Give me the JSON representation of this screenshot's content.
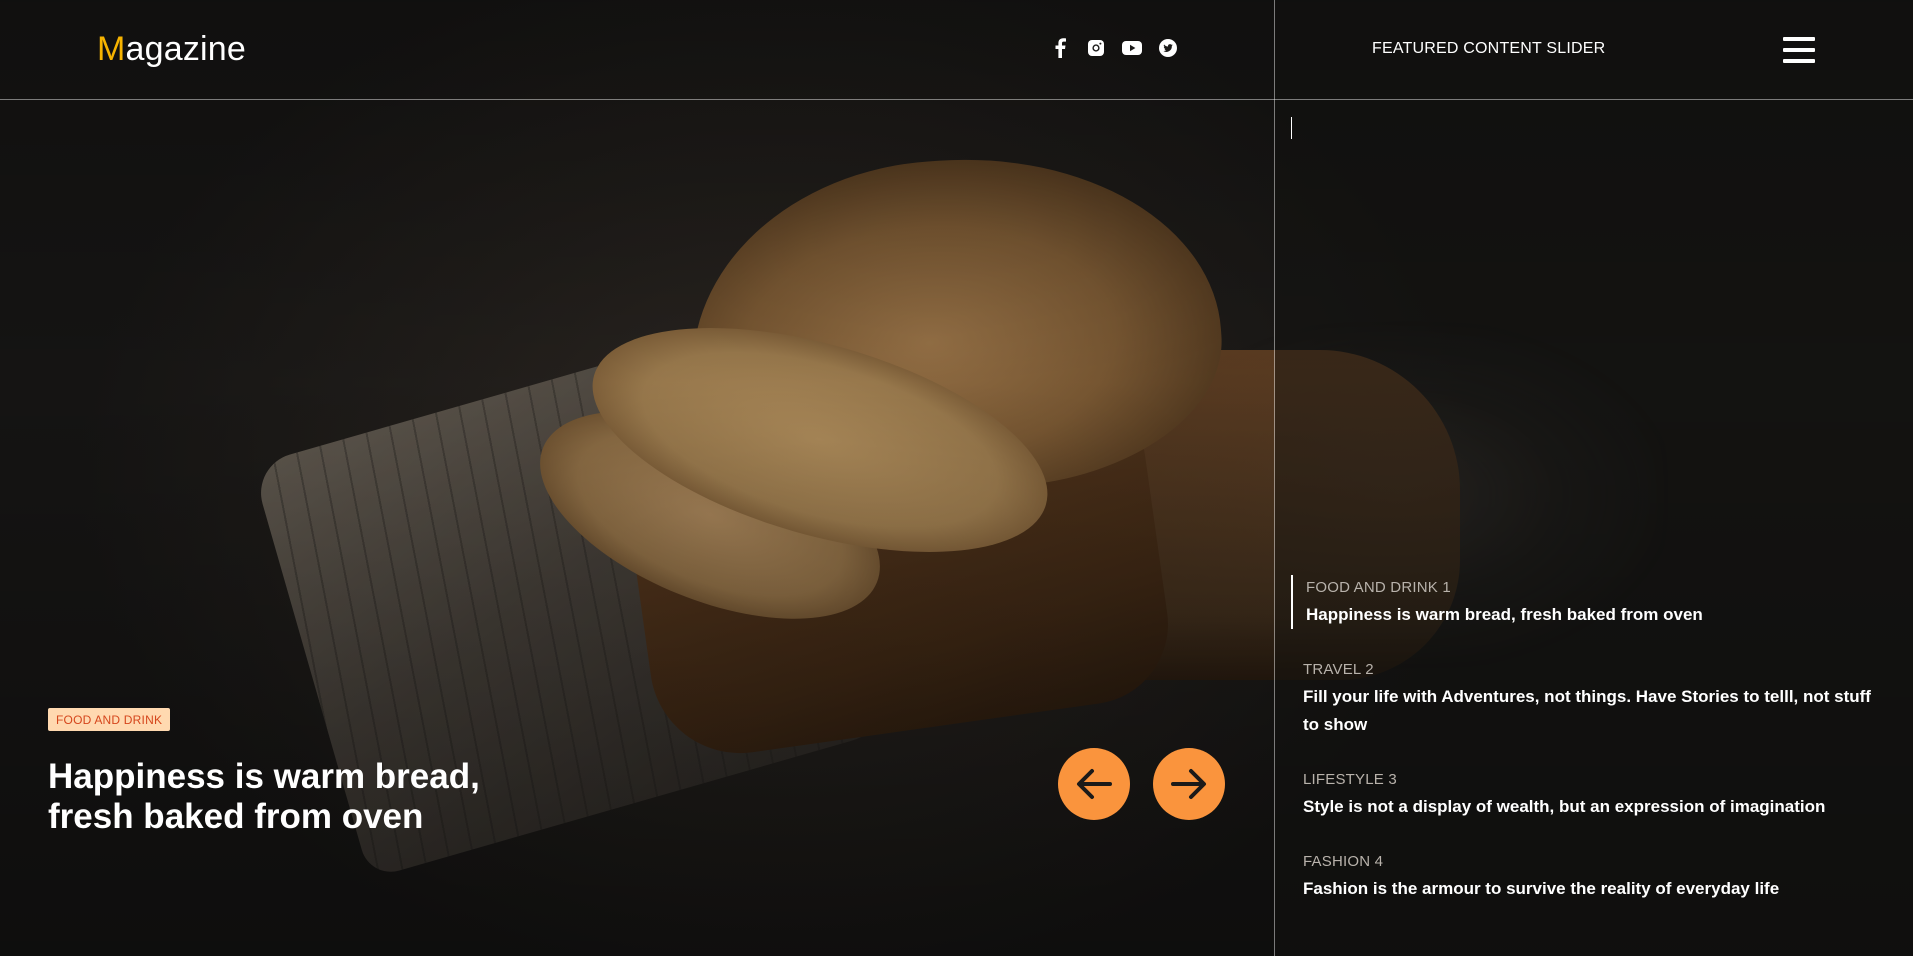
{
  "header": {
    "logo_first_letter": "M",
    "logo_rest": "agazine",
    "social_icons": [
      "facebook-icon",
      "instagram-icon",
      "youtube-icon",
      "twitter-icon"
    ],
    "featured_title": "FEATURED CONTENT SLIDER",
    "menu_icon": "hamburger-menu-icon"
  },
  "hero": {
    "tag": "FOOD AND DRINK",
    "title": "Happiness is warm bread, fresh baked from oven",
    "prev_icon": "arrow-left-icon",
    "next_icon": "arrow-right-icon"
  },
  "slides": [
    {
      "category": "FOOD AND DRINK 1",
      "title": "Happiness is warm bread, fresh baked from oven",
      "active": true
    },
    {
      "category": "TRAVEL 2",
      "title": "Fill your life with Adventures, not things. Have Stories to telll, not stuff to show",
      "active": false
    },
    {
      "category": "LIFESTYLE 3",
      "title": "Style is not a display of wealth, but an expression of imagination",
      "active": false
    },
    {
      "category": "FASHION 4",
      "title": "Fashion is the armour to survive the reality of everyday life",
      "active": false
    }
  ],
  "colors": {
    "accent": "#fa943d",
    "logo_accent": "#f6b300",
    "tag_bg": "#ffd9b0",
    "tag_text": "#d5461c"
  }
}
